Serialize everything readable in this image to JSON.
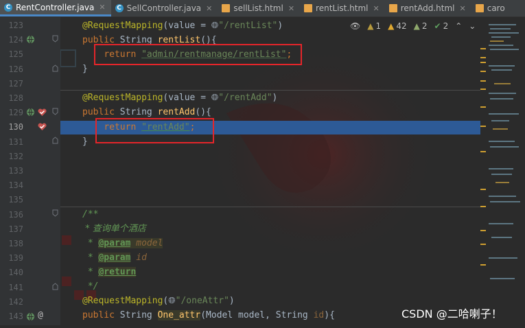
{
  "tabs": [
    {
      "label": "RentController.java",
      "type": "class",
      "active": true
    },
    {
      "label": "SellController.java",
      "type": "class",
      "active": false
    },
    {
      "label": "sellList.html",
      "type": "html",
      "active": false
    },
    {
      "label": "rentList.html",
      "type": "html",
      "active": false
    },
    {
      "label": "rentAdd.html",
      "type": "html",
      "active": false
    },
    {
      "label": "caro",
      "type": "html",
      "active": false
    }
  ],
  "inspections": {
    "weak_warnings": "1",
    "warnings": "42",
    "typos": "2",
    "ok": "2"
  },
  "line_numbers": [
    "123",
    "124",
    "125",
    "126",
    "127",
    "128",
    "129",
    "130",
    "131",
    "132",
    "133",
    "134",
    "135",
    "136",
    "137",
    "138",
    "139",
    "140",
    "141",
    "142",
    "143"
  ],
  "code": {
    "l123_ann": "@RequestMapping",
    "l123_a": "(value = ",
    "l123_str": "\"/rentList\"",
    "l123_b": ")",
    "l124_kw": "public ",
    "l124_type": "String ",
    "l124_fn": "rentList",
    "l124_b": "(){",
    "l125_kw": "return ",
    "l125_str": "\"admin/rentmanage/rentList\"",
    "l125_b": ";",
    "l126": "}",
    "l128_ann": "@RequestMapping",
    "l128_a": "(value = ",
    "l128_str": "\"/rentAdd\"",
    "l128_b": ")",
    "l129_kw": "public ",
    "l129_type": "String ",
    "l129_fn": "rentAdd",
    "l129_b": "(){",
    "l130_kw": "return ",
    "l130_str": "\"rentAdd\"",
    "l130_b": ";",
    "l131": "}",
    "l136": "/**",
    "l137": " * 查询单个酒店",
    "l138_star": " * ",
    "l138_tag": "@param",
    "l138_p": " model",
    "l139_star": " * ",
    "l139_tag": "@param",
    "l139_p": " id",
    "l140_star": " * ",
    "l140_tag": "@return",
    "l141": " */",
    "l142_ann": "@RequestMapping",
    "l142_a": "(",
    "l142_str": "\"/oneAttr\"",
    "l142_b": ")",
    "l143_kw": "public ",
    "l143_type": "String ",
    "l143_fn": "One_attr",
    "l143_a": "(Model model, String ",
    "l143_p": "id",
    "l143_b": "){"
  },
  "watermark": "CSDN @二哈喇子！",
  "colors": {
    "highlight": "#2d5a96",
    "redbox": "#e5252a",
    "annotation": "#bbb529",
    "keyword": "#cc7832",
    "string": "#6a8759"
  }
}
